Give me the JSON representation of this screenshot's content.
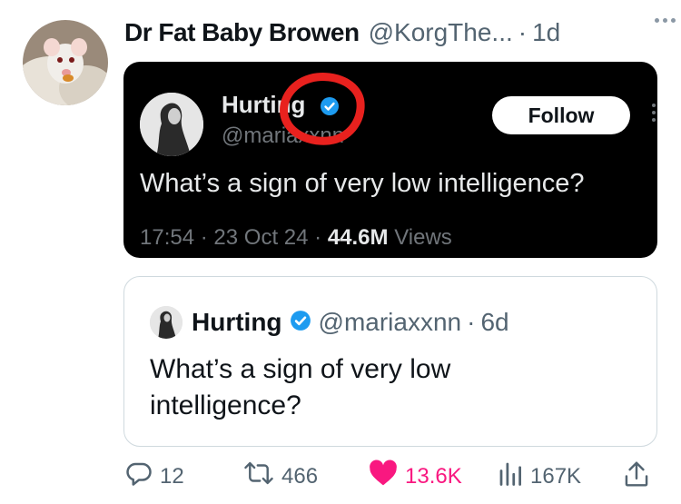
{
  "tweet": {
    "author_name": "Dr Fat Baby Browen",
    "author_handle": "@KorgThe...",
    "separator": "·",
    "time": "1d"
  },
  "screenshot": {
    "author_name": "Hurting",
    "author_handle": "@mariaxxnn",
    "follow_label": "Follow",
    "text": "What’s a sign of very low intelligence?",
    "time": "17:54",
    "date": "23 Oct 24",
    "views_count": "44.6M",
    "views_label": "Views",
    "separator": "·"
  },
  "quote": {
    "author_name": "Hurting",
    "author_handle": "@mariaxxnn",
    "separator": "·",
    "time": "6d",
    "text": "What’s a sign of very low intelligence?"
  },
  "actions": {
    "replies": "12",
    "reposts": "466",
    "likes": "13.6K",
    "views": "167K"
  },
  "colors": {
    "verified_blue": "#1d9bf0",
    "like_pink": "#f91880",
    "annotation_red": "#e8211e"
  }
}
